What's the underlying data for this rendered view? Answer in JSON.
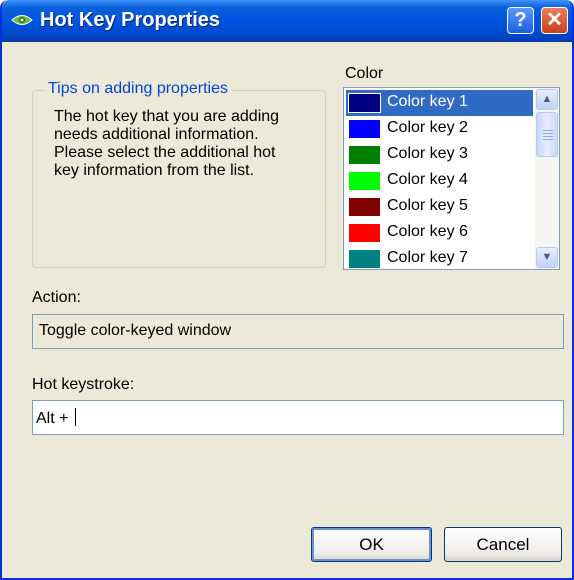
{
  "window": {
    "title": "Hot Key Properties",
    "help_glyph": "?",
    "close_glyph": "✕"
  },
  "tips": {
    "legend": "Tips on adding properties",
    "text": "The hot key that you are adding\nneeds additional information.\nPlease select the additional hot\nkey information from the list."
  },
  "color": {
    "label": "Color",
    "items": [
      {
        "label": "Color key 1",
        "swatch": "#000080",
        "selected": true
      },
      {
        "label": "Color key 2",
        "swatch": "#0000ff"
      },
      {
        "label": "Color key 3",
        "swatch": "#008000"
      },
      {
        "label": "Color key 4",
        "swatch": "#00ff00"
      },
      {
        "label": "Color key 5",
        "swatch": "#800000"
      },
      {
        "label": "Color key 6",
        "swatch": "#ff0000"
      },
      {
        "label": "Color key 7",
        "swatch": "#008080"
      }
    ],
    "scroll_up_glyph": "▲",
    "scroll_down_glyph": "▼"
  },
  "action": {
    "label": "Action:",
    "value": "Toggle color-keyed window"
  },
  "hotkey": {
    "label": "Hot keystroke:",
    "value": "Alt + "
  },
  "buttons": {
    "ok": "OK",
    "cancel": "Cancel"
  }
}
